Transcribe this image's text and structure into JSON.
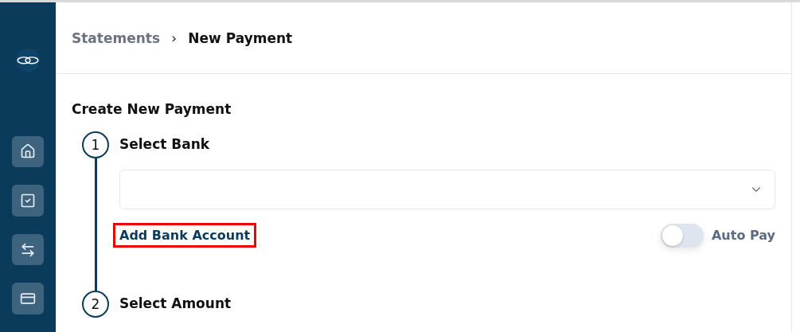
{
  "sidebar": {
    "items": [
      {
        "selected": false
      },
      {
        "selected": false
      },
      {
        "selected": false
      },
      {
        "selected": false
      }
    ]
  },
  "breadcrumb": [
    {
      "label": "Statements",
      "current": false
    },
    {
      "label": "New Payment",
      "current": true
    }
  ],
  "separator": "›",
  "page_title": "Create New Payment",
  "steps": [
    {
      "number": "1",
      "title": "Select Bank",
      "select": {
        "expanded": false
      },
      "link": {
        "label": "Add Bank Account",
        "highlighted": true
      },
      "toggle": {
        "label": "Auto Pay",
        "on": false
      }
    },
    {
      "number": "2",
      "title": "Select Amount"
    }
  ]
}
